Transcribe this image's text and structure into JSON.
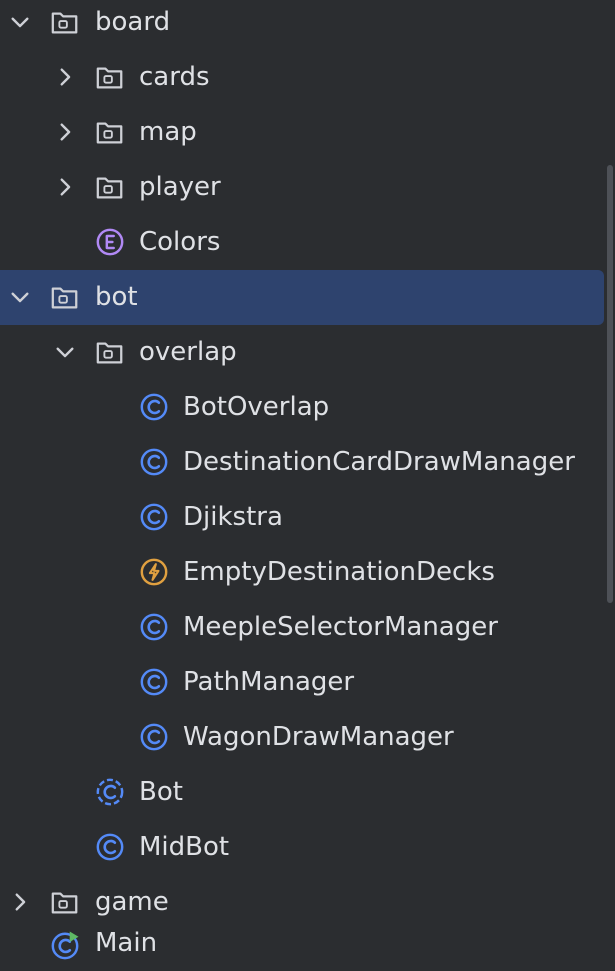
{
  "tree": {
    "items": [
      {
        "label": "board",
        "kind": "folder",
        "expanded": true,
        "level": 0
      },
      {
        "label": "cards",
        "kind": "folder",
        "expanded": false,
        "level": 1
      },
      {
        "label": "map",
        "kind": "folder",
        "expanded": false,
        "level": 1
      },
      {
        "label": "player",
        "kind": "folder",
        "expanded": false,
        "level": 1
      },
      {
        "label": "Colors",
        "kind": "enum",
        "level": 1
      },
      {
        "label": "bot",
        "kind": "folder",
        "expanded": true,
        "level": 0,
        "selected": true
      },
      {
        "label": "overlap",
        "kind": "folder",
        "expanded": true,
        "level": 1
      },
      {
        "label": "BotOverlap",
        "kind": "class",
        "level": 2
      },
      {
        "label": "DestinationCardDrawManager",
        "kind": "class",
        "level": 2
      },
      {
        "label": "Djikstra",
        "kind": "class",
        "level": 2
      },
      {
        "label": "EmptyDestinationDecks",
        "kind": "exception",
        "level": 2
      },
      {
        "label": "MeepleSelectorManager",
        "kind": "class",
        "level": 2
      },
      {
        "label": "PathManager",
        "kind": "class",
        "level": 2
      },
      {
        "label": "WagonDrawManager",
        "kind": "class",
        "level": 2
      },
      {
        "label": "Bot",
        "kind": "abstract-class",
        "level": 1
      },
      {
        "label": "MidBot",
        "kind": "class",
        "level": 1
      },
      {
        "label": "game",
        "kind": "folder",
        "expanded": false,
        "level": 0
      },
      {
        "label": "Main",
        "kind": "runnable-class",
        "level": 0
      }
    ]
  },
  "colors": {
    "background": "#2b2d30",
    "selection": "#2e436e",
    "text": "#dfe1e5",
    "class_icon": "#548af7",
    "enum_icon": "#b189f5",
    "exception_icon": "#e0a040",
    "run_badge": "#5fb865"
  }
}
